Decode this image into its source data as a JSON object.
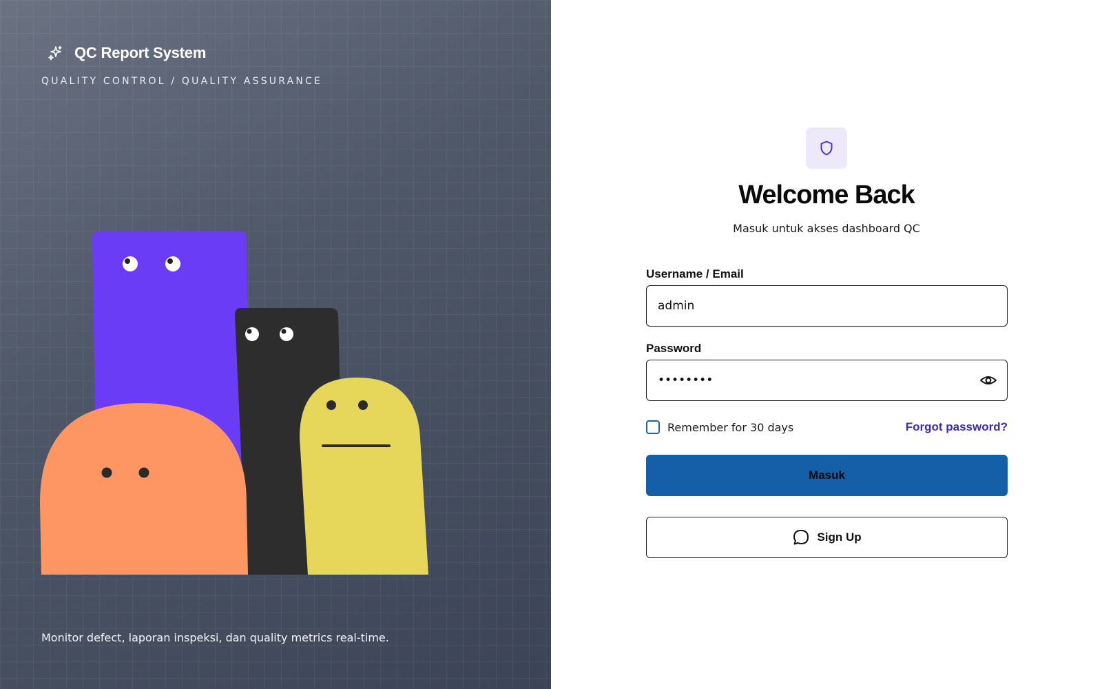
{
  "brand": {
    "icon": "sparkle-icon",
    "title": "QC Report System",
    "subtitle": "QUALITY CONTROL / QUALITY ASSURANCE"
  },
  "left_footer": "Monitor defect, laporan inspeksi, dan quality metrics real-time.",
  "illustration": {
    "characters": [
      "purple-character",
      "black-character",
      "yellow-character",
      "orange-character"
    ],
    "colors": {
      "purple": "#6b3cf5",
      "black": "#2d2d2d",
      "yellow": "#e6d65a",
      "orange": "#fe9663"
    }
  },
  "login": {
    "logo_icon": "shield-icon",
    "heading": "Welcome Back",
    "subheading": "Masuk untuk akses dashboard QC",
    "username_label": "Username / Email",
    "username_value": "admin",
    "password_label": "Password",
    "password_value": "password",
    "password_toggle_icon": "eye-icon",
    "remember_label": "Remember for 30 days",
    "remember_checked": false,
    "forgot_label": "Forgot password?",
    "submit_label": "Masuk",
    "signup_icon": "chat-bubble-icon",
    "signup_label": "Sign Up"
  },
  "colors": {
    "primary": "#155fa9",
    "link": "#3b2bb8",
    "logo_bg": "#ede9fb",
    "logo_icon": "#4b35c9"
  }
}
